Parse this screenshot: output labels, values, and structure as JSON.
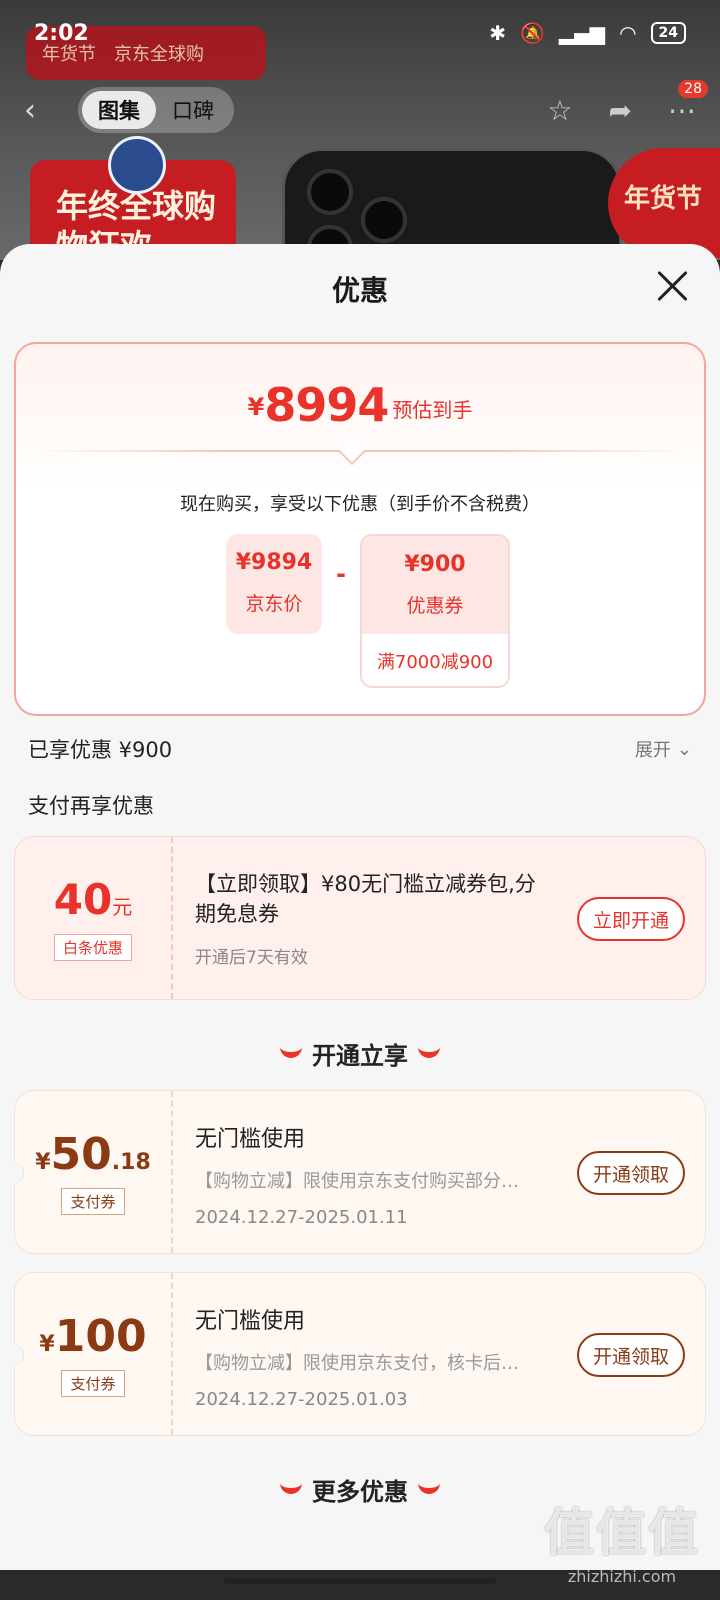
{
  "status_bar": {
    "time": "2:02",
    "battery": "24"
  },
  "background": {
    "store_tag": "年货节",
    "store_name": "京东全球购",
    "tabs": [
      {
        "label": "图集",
        "active": true
      },
      {
        "label": "口碑",
        "active": false
      }
    ],
    "more_badge": "28",
    "promo_left": "年终全球购物狂欢",
    "promo_right": "年货节"
  },
  "sheet": {
    "title": "优惠",
    "price_card": {
      "currency": "¥",
      "final_price": "8994",
      "final_label": "预估到手",
      "explain": "现在购买，享受以下优惠（到手价不含税费）",
      "jd_price": "¥9894",
      "jd_label": "京东价",
      "minus": "-",
      "coupon_value": "¥900",
      "coupon_label": "优惠券",
      "coupon_rule": "满7000减900"
    },
    "enjoyed": "已享优惠 ¥900",
    "expand_label": "展开",
    "pay_more": "支付再享优惠",
    "baitiao": {
      "amount": "40",
      "unit": "元",
      "tag": "白条优惠",
      "title": "【立即领取】¥80无门槛立减券包,分期免息券",
      "sub": "开通后7天有效",
      "button": "立即开通"
    },
    "section_open": "开通立享",
    "pay_coupons": [
      {
        "yen": "¥",
        "amount_int": "50",
        "amount_dec": ".18",
        "tag": "支付券",
        "title": "无门槛使用",
        "desc": "【购物立减】限使用京东支付购买部分商品",
        "date": "2024.12.27-2025.01.11",
        "button": "开通领取"
      },
      {
        "yen": "¥",
        "amount_int": "100",
        "amount_dec": "",
        "tag": "支付券",
        "title": "无门槛使用",
        "desc": "【购物立减】限使用京东支付，核卡后使用",
        "date": "2024.12.27-2025.01.03",
        "button": "开通领取"
      }
    ],
    "section_more": "更多优惠"
  },
  "watermark": {
    "big": "值值值",
    "small": "zhizhizhi.com"
  },
  "colors": {
    "accent": "#e8322a",
    "coupon_brown": "#8a3b14",
    "sheet_bg": "#f6f6f6"
  }
}
